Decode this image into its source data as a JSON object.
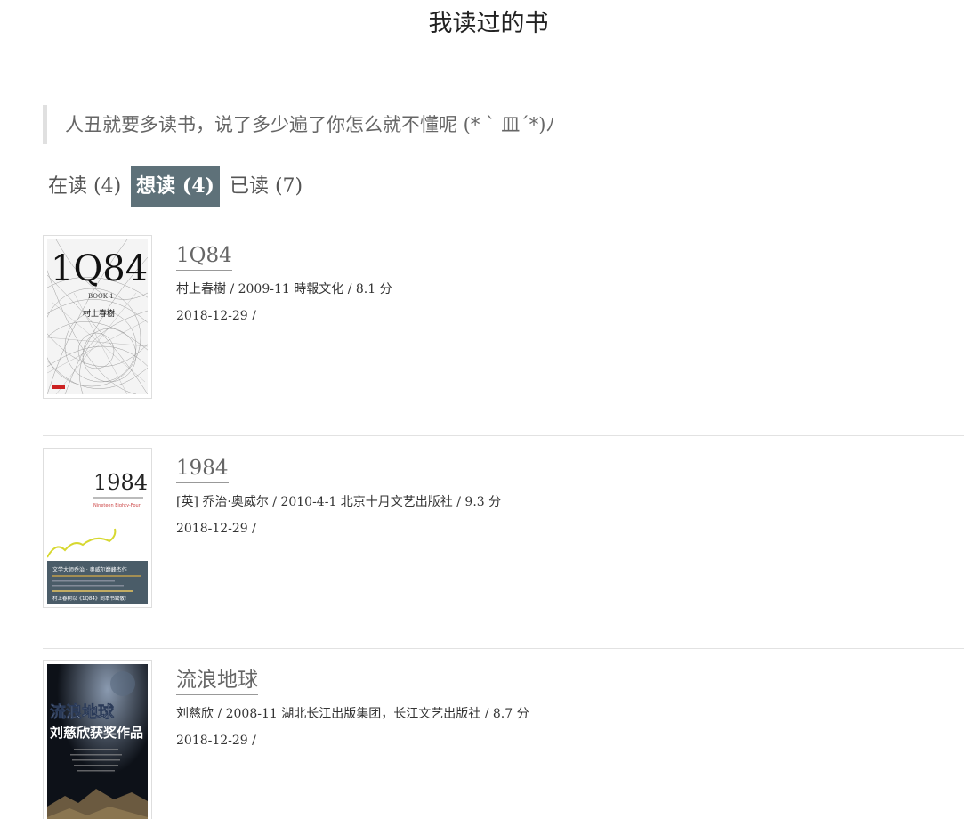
{
  "page": {
    "title": "我读过的书",
    "quote": "人丑就要多读书，说了多少遍了你怎么就不懂呢 (* ` 皿´*)ﾉ"
  },
  "tabs": [
    {
      "label": "在读 (4)",
      "active": false
    },
    {
      "label": "想读 (4)",
      "active": true
    },
    {
      "label": "已读 (7)",
      "active": false
    }
  ],
  "books": [
    {
      "title": "1Q84",
      "meta": "村上春樹 / 2009-11 時報文化 / 8.1 分",
      "date": "2018-12-29 /",
      "cover": {
        "big_text": "1Q84",
        "sub_text": "BOOK 1",
        "author": "村上春樹"
      }
    },
    {
      "title": "1984",
      "meta": "[英] 乔治·奥威尔 / 2010-4-1 北京十月文艺出版社 / 9.3 分",
      "date": "2018-12-29 /",
      "cover": {
        "big_text": "1984",
        "english": "Nineteen Eighty-Four",
        "band_line1": "文学大师乔治 · 奥威尔巅峰杰作",
        "band_line2": "村上春树以《1Q84》向本书致敬!"
      }
    },
    {
      "title": "流浪地球",
      "meta": "刘慈欣 / 2008-11 湖北长江出版集团，长江文艺出版社 / 8.7 分",
      "date": "2018-12-29 /",
      "cover": {
        "big_text": "流浪地球",
        "sub_text": "刘慈欣获奖作品"
      }
    }
  ]
}
